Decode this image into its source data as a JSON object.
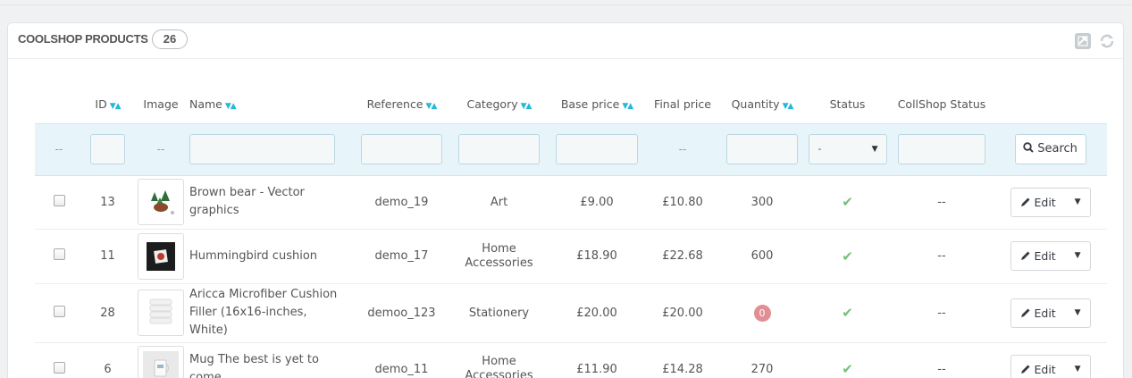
{
  "panel": {
    "title": "COOLSHOP PRODUCTS",
    "count": "26"
  },
  "columns": {
    "id": "ID",
    "image": "Image",
    "name": "Name",
    "reference": "Reference",
    "category": "Category",
    "base_price": "Base price",
    "final_price": "Final price",
    "quantity": "Quantity",
    "status": "Status",
    "coolshop_status": "CollShop Status"
  },
  "sort_glyph": "▼▲",
  "filter": {
    "empty": "--",
    "status_select": "-",
    "search_label": "Search"
  },
  "rows": [
    {
      "id": "13",
      "name": "Brown bear - Vector graphics",
      "reference": "demo_19",
      "category": "Art",
      "base_price": "£9.00",
      "final_price": "£10.80",
      "quantity": "300",
      "status": "✔",
      "coolshop_status": "--",
      "edit": "Edit"
    },
    {
      "id": "11",
      "name": "Hummingbird cushion",
      "reference": "demo_17",
      "category": "Home Accessories",
      "base_price": "£18.90",
      "final_price": "£22.68",
      "quantity": "600",
      "status": "✔",
      "coolshop_status": "--",
      "edit": "Edit"
    },
    {
      "id": "28",
      "name": "Aricca Microfiber Cushion Filler (16x16-inches, White)",
      "reference": "demoo_123",
      "category": "Stationery",
      "base_price": "£20.00",
      "final_price": "£20.00",
      "quantity": "0",
      "status": "✔",
      "coolshop_status": "--",
      "edit": "Edit"
    },
    {
      "id": "6",
      "name": "Mug The best is yet to come",
      "reference": "demo_11",
      "category": "Home Accessories",
      "base_price": "£11.90",
      "final_price": "£14.28",
      "quantity": "270",
      "status": "✔",
      "coolshop_status": "--",
      "edit": "Edit"
    }
  ],
  "icons": {
    "export": "export-icon",
    "refresh": "refresh-icon",
    "search": "search-icon",
    "pencil": "pencil-icon",
    "caret": "caret-down-icon"
  }
}
